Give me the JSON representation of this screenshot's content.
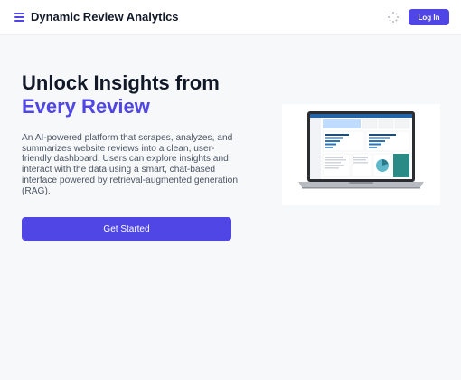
{
  "navbar": {
    "brand": "Dynamic Review Analytics",
    "menu_icon": "hamburger-menu-icon",
    "loading_icon": "dotted-spinner-icon",
    "login_label": "Log In"
  },
  "hero": {
    "title_line1": "Unlock Insights from",
    "title_line2": "Every Review",
    "description": "An AI-powered platform that scrapes, analyzes, and summarizes website reviews into a clean, user-friendly dashboard. Users can explore insights and interact with the data using a smart, chat-based interface powered by retrieval-augmented generation (RAG).",
    "cta_label": "Get Started"
  },
  "hero_image": {
    "subject": "laptop showing analytics dashboard"
  },
  "colors": {
    "accent": "#4f46e5",
    "background": "#f7f8fa",
    "navbar": "#ffffff",
    "text_primary": "#111827",
    "text_secondary": "#4b5563"
  }
}
